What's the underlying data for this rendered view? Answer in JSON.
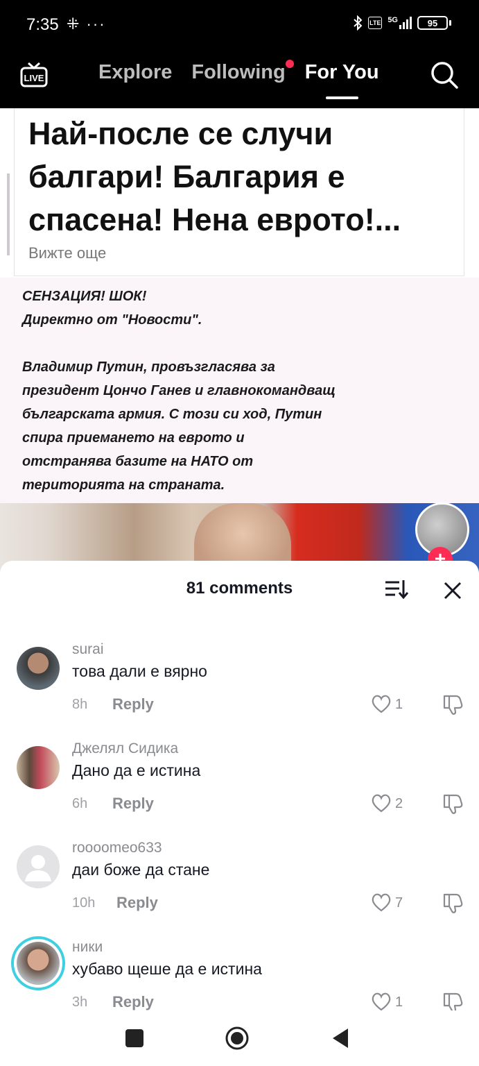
{
  "status_bar": {
    "time": "7:35",
    "left_icons": "⁜ ···",
    "network": "5G",
    "volte": "Vo LTE",
    "battery": "95"
  },
  "top_nav": {
    "live_label": "LIVE",
    "tabs": [
      {
        "label": "Explore"
      },
      {
        "label": "Following"
      },
      {
        "label": "For You"
      }
    ]
  },
  "post": {
    "headline": "Най-после се случи балгари! Балгария е спасена! Нена еврото!...",
    "see_more": "Вижте още",
    "news_text": "СЕНЗАЦИЯ! ШОК!\nДиректно от \"Новости\".\n\nВладимир Путин, провъзгласява за\nпрезидент Цончо Ганев и главнокомандващ\nбългарската армия. С този си ход, Путин\nспира приемането на еврото и\nотстранява базите на НАТО от\nтериторията на страната."
  },
  "comments_sheet": {
    "title": "81 comments",
    "comments": [
      {
        "username": "surai",
        "text": "това дали е вярно",
        "time": "8h",
        "reply": "Reply",
        "likes": "1"
      },
      {
        "username": "Джелял Сидика",
        "text": "Дано да е истина",
        "time": "6h",
        "reply": "Reply",
        "likes": "2"
      },
      {
        "username": "roooomeo633",
        "text": "даи боже да стане",
        "time": "10h",
        "reply": "Reply",
        "likes": "7"
      },
      {
        "username": "ники",
        "text": "хубаво щеше да е истина",
        "time": "3h",
        "reply": "Reply",
        "likes": "1"
      }
    ]
  },
  "colors": {
    "accent": "#fe2c55",
    "story_ring": "#3ed0e0"
  }
}
